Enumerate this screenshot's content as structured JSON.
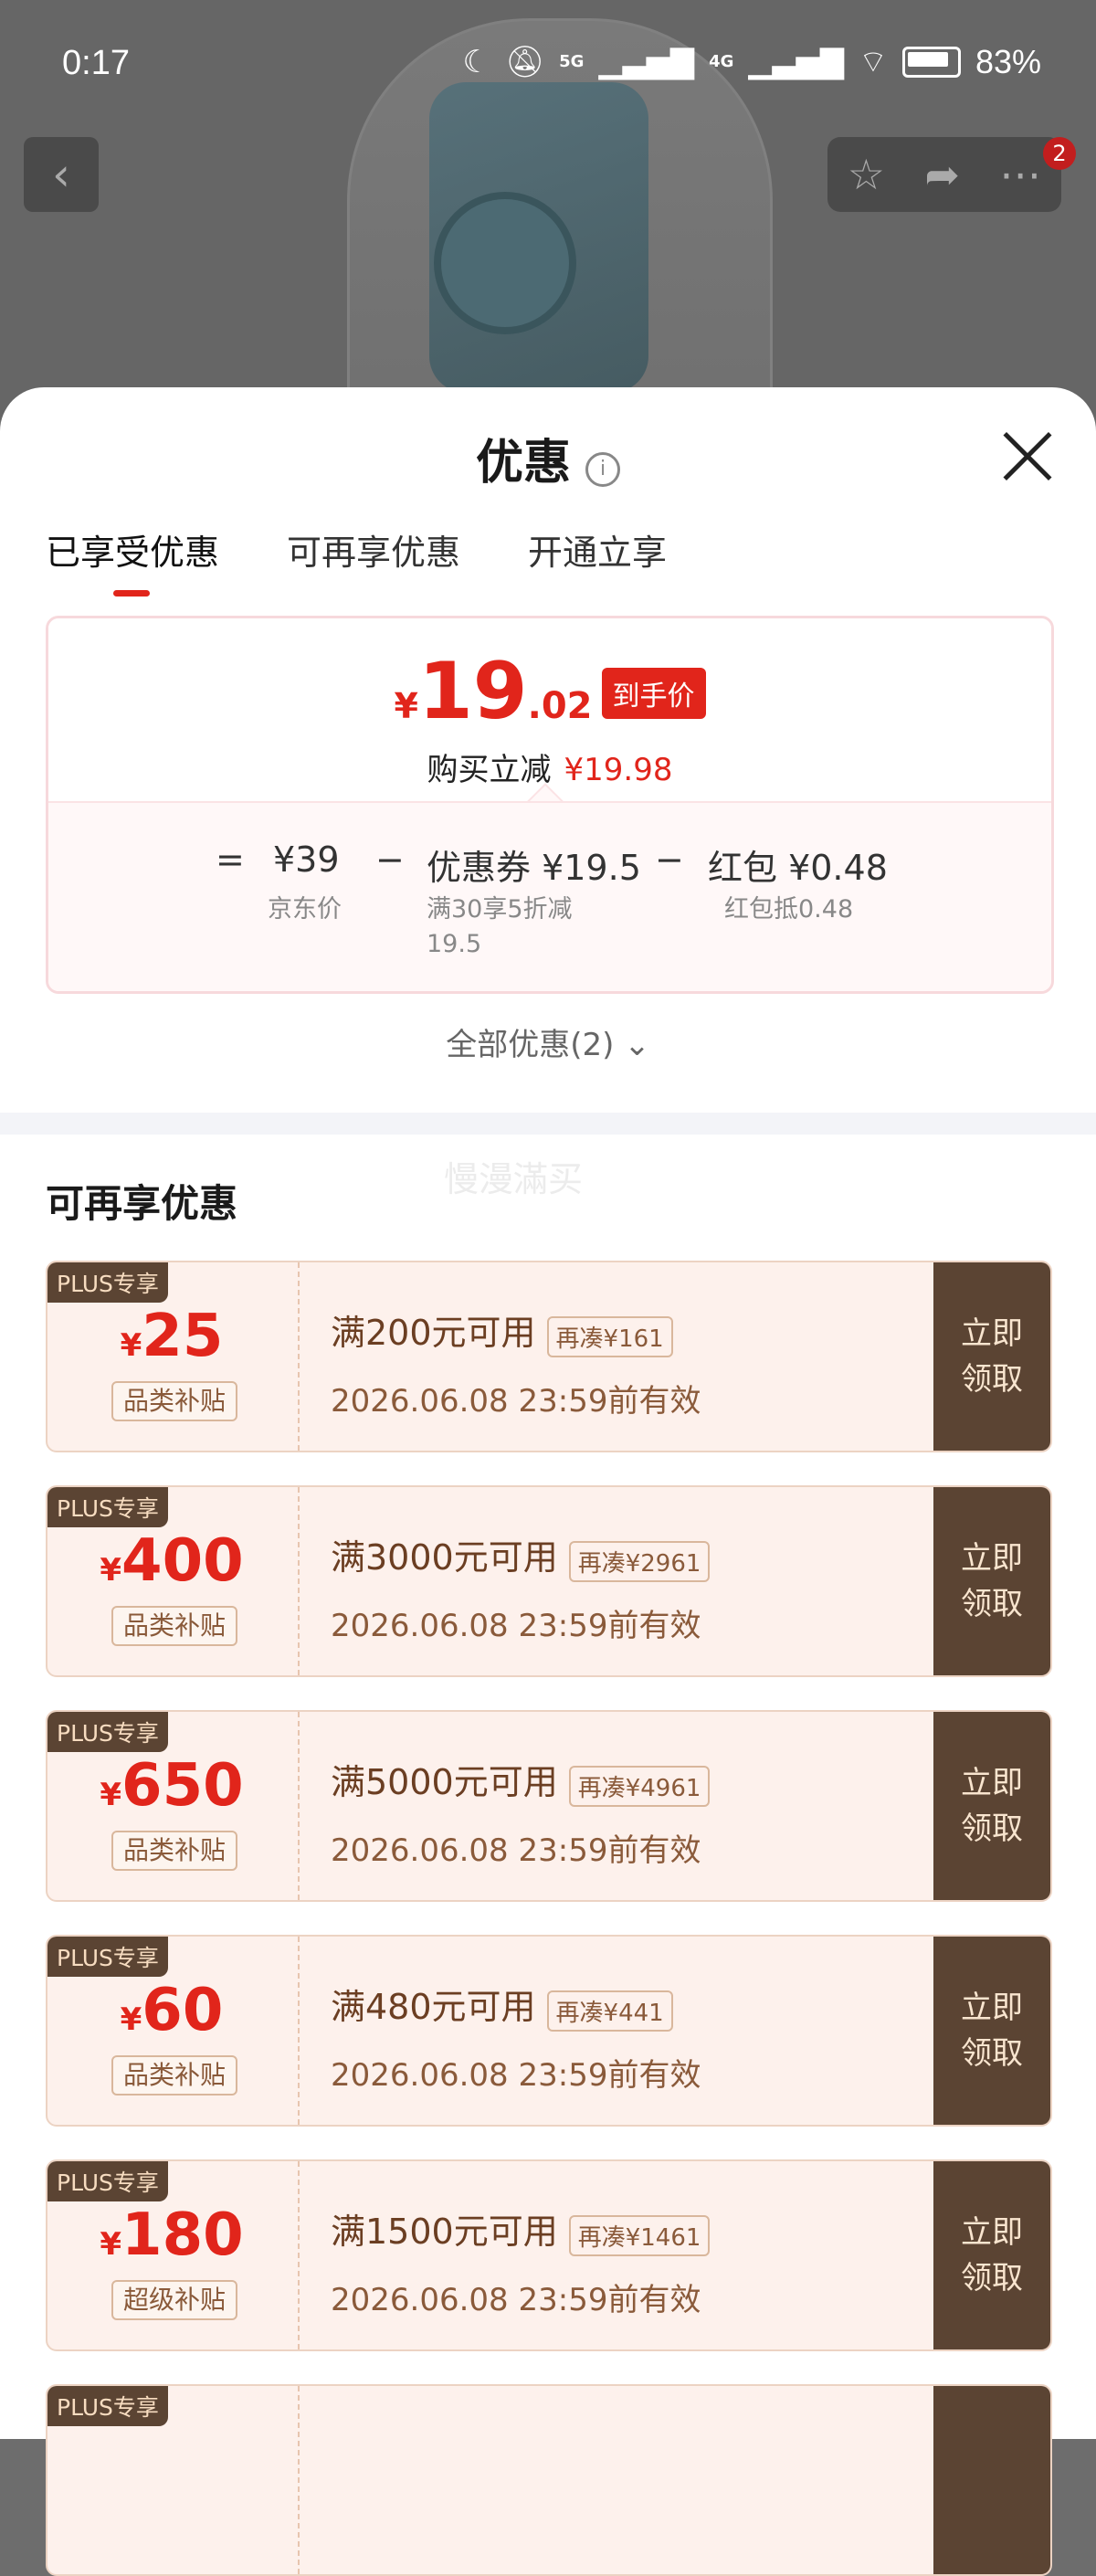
{
  "status_bar": {
    "time": "0:17",
    "signal_1": "5G",
    "signal_2": "4G",
    "battery": "83%"
  },
  "nav": {
    "badge": "2"
  },
  "sheet": {
    "title": "优惠",
    "tabs": [
      {
        "label": "已享受优惠"
      },
      {
        "label": "可再享优惠"
      },
      {
        "label": "开通立享"
      }
    ],
    "summary": {
      "yen": "¥",
      "price_int": "19",
      "price_dec": ".02",
      "price_tag": "到手价",
      "reduce_label": "购买立减",
      "reduce_amount": "¥19.98",
      "eq": "=",
      "base_price": "¥39",
      "base_label": "京东价",
      "minus1": "−",
      "coupon_value": "优惠券 ¥19.5",
      "coupon_desc": "满30享5折减19.5",
      "minus2": "−",
      "redpack_value": "红包 ¥0.48",
      "redpack_desc": "红包抵0.48"
    },
    "all_offers": "全部优惠(2)",
    "section_title": "可再享优惠",
    "watermark": "慢漫滿买"
  },
  "coupons": [
    {
      "plus_tag": "PLUS专享",
      "yen": "¥",
      "amount": "25",
      "category": "品类补贴",
      "condition": "满200元可用",
      "gap": "再凑¥161",
      "validity": "2026.06.08 23:59前有效",
      "claim": "立即领取"
    },
    {
      "plus_tag": "PLUS专享",
      "yen": "¥",
      "amount": "400",
      "category": "品类补贴",
      "condition": "满3000元可用",
      "gap": "再凑¥2961",
      "validity": "2026.06.08 23:59前有效",
      "claim": "立即领取"
    },
    {
      "plus_tag": "PLUS专享",
      "yen": "¥",
      "amount": "650",
      "category": "品类补贴",
      "condition": "满5000元可用",
      "gap": "再凑¥4961",
      "validity": "2026.06.08 23:59前有效",
      "claim": "立即领取"
    },
    {
      "plus_tag": "PLUS专享",
      "yen": "¥",
      "amount": "60",
      "category": "品类补贴",
      "condition": "满480元可用",
      "gap": "再凑¥441",
      "validity": "2026.06.08 23:59前有效",
      "claim": "立即领取"
    },
    {
      "plus_tag": "PLUS专享",
      "yen": "¥",
      "amount": "180",
      "category": "超级补贴",
      "condition": "满1500元可用",
      "gap": "再凑¥1461",
      "validity": "2026.06.08 23:59前有效",
      "claim": "立即领取"
    },
    {
      "plus_tag": "PLUS专享",
      "yen": "",
      "amount": "",
      "category": "",
      "condition": "",
      "gap": "",
      "validity": "",
      "claim": ""
    }
  ]
}
